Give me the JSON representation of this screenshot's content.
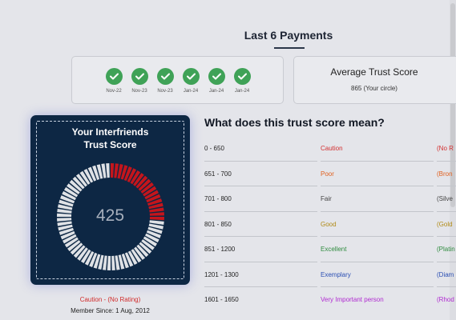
{
  "header": {
    "title": "Last 6 Payments"
  },
  "payments": [
    {
      "label": "Nov-22",
      "status": "paid",
      "icon": "check-icon"
    },
    {
      "label": "Nov-23",
      "status": "paid",
      "icon": "check-icon"
    },
    {
      "label": "Nov-23",
      "status": "paid",
      "icon": "check-icon"
    },
    {
      "label": "Jan-24",
      "status": "paid",
      "icon": "check-icon"
    },
    {
      "label": "Jan-24",
      "status": "paid",
      "icon": "check-icon"
    },
    {
      "label": "Jan-24",
      "status": "paid",
      "icon": "check-icon"
    }
  ],
  "average": {
    "title": "Average Trust Score",
    "value": "865 (Your circle)"
  },
  "score_card": {
    "title_line1": "Your Interfriends",
    "title_line2": "Trust Score",
    "score": "425",
    "gauge_fraction": 0.27,
    "filled_color": "#c4151c",
    "empty_color": "#dfe2e6"
  },
  "rating": {
    "label": "Caution - (No Rating)",
    "member_since": "Member Since: 1 Aug, 2012"
  },
  "meaning": {
    "title": "What does this trust score mean?",
    "rows": [
      {
        "range": "0 - 650",
        "label": "Caution",
        "tier": "(No R",
        "color": "#d32f2f"
      },
      {
        "range": "651 - 700",
        "label": "Poor",
        "tier": "(Bron",
        "color": "#e0601f"
      },
      {
        "range": "701 - 800",
        "label": "Fair",
        "tier": "(Silve",
        "color": "#444444"
      },
      {
        "range": "801 - 850",
        "label": "Good",
        "tier": "(Gold",
        "color": "#b08a16"
      },
      {
        "range": "851 - 1200",
        "label": "Excellent",
        "tier": "(Platin",
        "color": "#2e8b3e"
      },
      {
        "range": "1201 - 1300",
        "label": "Exemplary",
        "tier": "(Diam",
        "color": "#2b4fb3"
      },
      {
        "range": "1601 - 1650",
        "label": "Very Important person",
        "tier": "(Rhod",
        "color": "#b02ad1"
      }
    ]
  }
}
